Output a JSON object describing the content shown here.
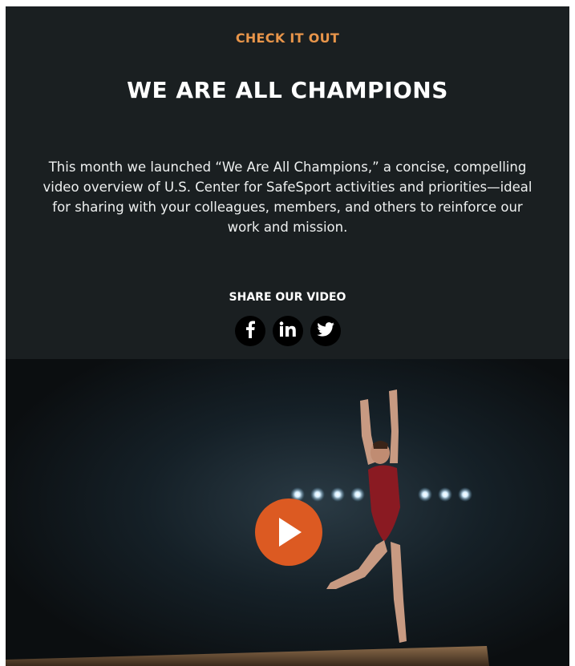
{
  "section": {
    "eyebrow": "CHECK IT OUT",
    "title": "WE ARE ALL CHAMPIONS",
    "body": "This month we launched “We Are All Champions,” a concise, compelling video overview of U.S. Center for SafeSport activities and priorities—ideal for sharing with your colleagues, members, and others to reinforce our work and mission."
  },
  "share": {
    "label": "SHARE OUR VIDEO",
    "buttons": [
      {
        "icon": "facebook-icon"
      },
      {
        "icon": "linkedin-icon"
      },
      {
        "icon": "twitter-icon"
      }
    ]
  },
  "video": {
    "thumbnail": "gymnast-on-balance-beam",
    "play_icon": "play-icon"
  },
  "colors": {
    "background": "#1a1f21",
    "accent": "#e8954a",
    "play": "#dc5a22"
  }
}
